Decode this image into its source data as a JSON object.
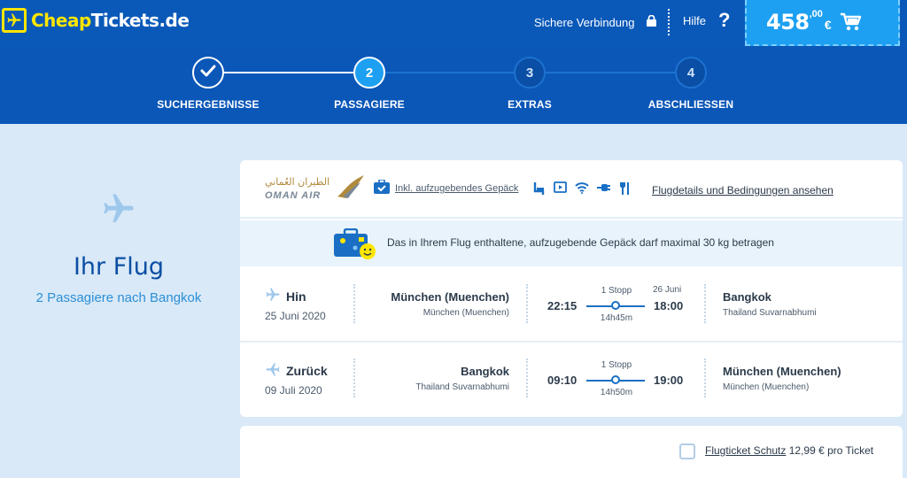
{
  "header": {
    "brand_part1": "Cheap",
    "brand_part2": "Tickets.de",
    "secure_label": "Sichere Verbindung",
    "help_label": "Hilfe",
    "help_symbol": "?",
    "price_main": "458",
    "price_cents": ",00",
    "currency": "€",
    "brand_color": "#0a59b9",
    "accent_color": "#1da0f2",
    "logo_yellow": "#ffe600"
  },
  "steps": [
    {
      "number": "",
      "label": "SUCHERGEBNISSE",
      "state": "done"
    },
    {
      "number": "2",
      "label": "PASSAGIERE",
      "state": "active"
    },
    {
      "number": "3",
      "label": "EXTRAS",
      "state": "todo"
    },
    {
      "number": "4",
      "label": "ABSCHLIESSEN",
      "state": "todo"
    }
  ],
  "sidebar": {
    "icon": "airplane-icon",
    "title": "Ihr Flug",
    "subtitle": "2 Passagiere nach Bangkok"
  },
  "flight": {
    "airline_arabic": "الطيران العُماني",
    "airline_name": "OMAN AIR",
    "baggage_link": "Inkl. aufzugebendes Gepäck",
    "amenities": [
      "seat-icon",
      "entertainment-icon",
      "wifi-icon",
      "power-plug-icon",
      "meal-icon"
    ],
    "details_link": "Flugdetails und Bedingungen ansehen",
    "notice": "Das in Ihrem Flug enthaltene, aufzugebende Gepäck darf maximal 30 kg betragen",
    "outbound": {
      "type": "Hin",
      "date": "25 Juni 2020",
      "from_city": "München (Muenchen)",
      "from_airport": "München (Muenchen)",
      "dep_time": "22:15",
      "stops": "1 Stopp",
      "duration": "14h45m",
      "arr_date": "26 Juni",
      "arr_time": "18:00",
      "to_city": "Bangkok",
      "to_airport": "Thailand Suvarnabhumi"
    },
    "return": {
      "type": "Zurück",
      "date": "09 Juli 2020",
      "from_city": "Bangkok",
      "from_airport": "Thailand Suvarnabhumi",
      "dep_time": "09:10",
      "stops": "1 Stopp",
      "duration": "14h50m",
      "arr_time": "19:00",
      "to_city": "München (Muenchen)",
      "to_airport": "München (Muenchen)"
    }
  },
  "protection": {
    "link": "Flugticket Schutz",
    "price": "12,99 € pro Ticket"
  }
}
